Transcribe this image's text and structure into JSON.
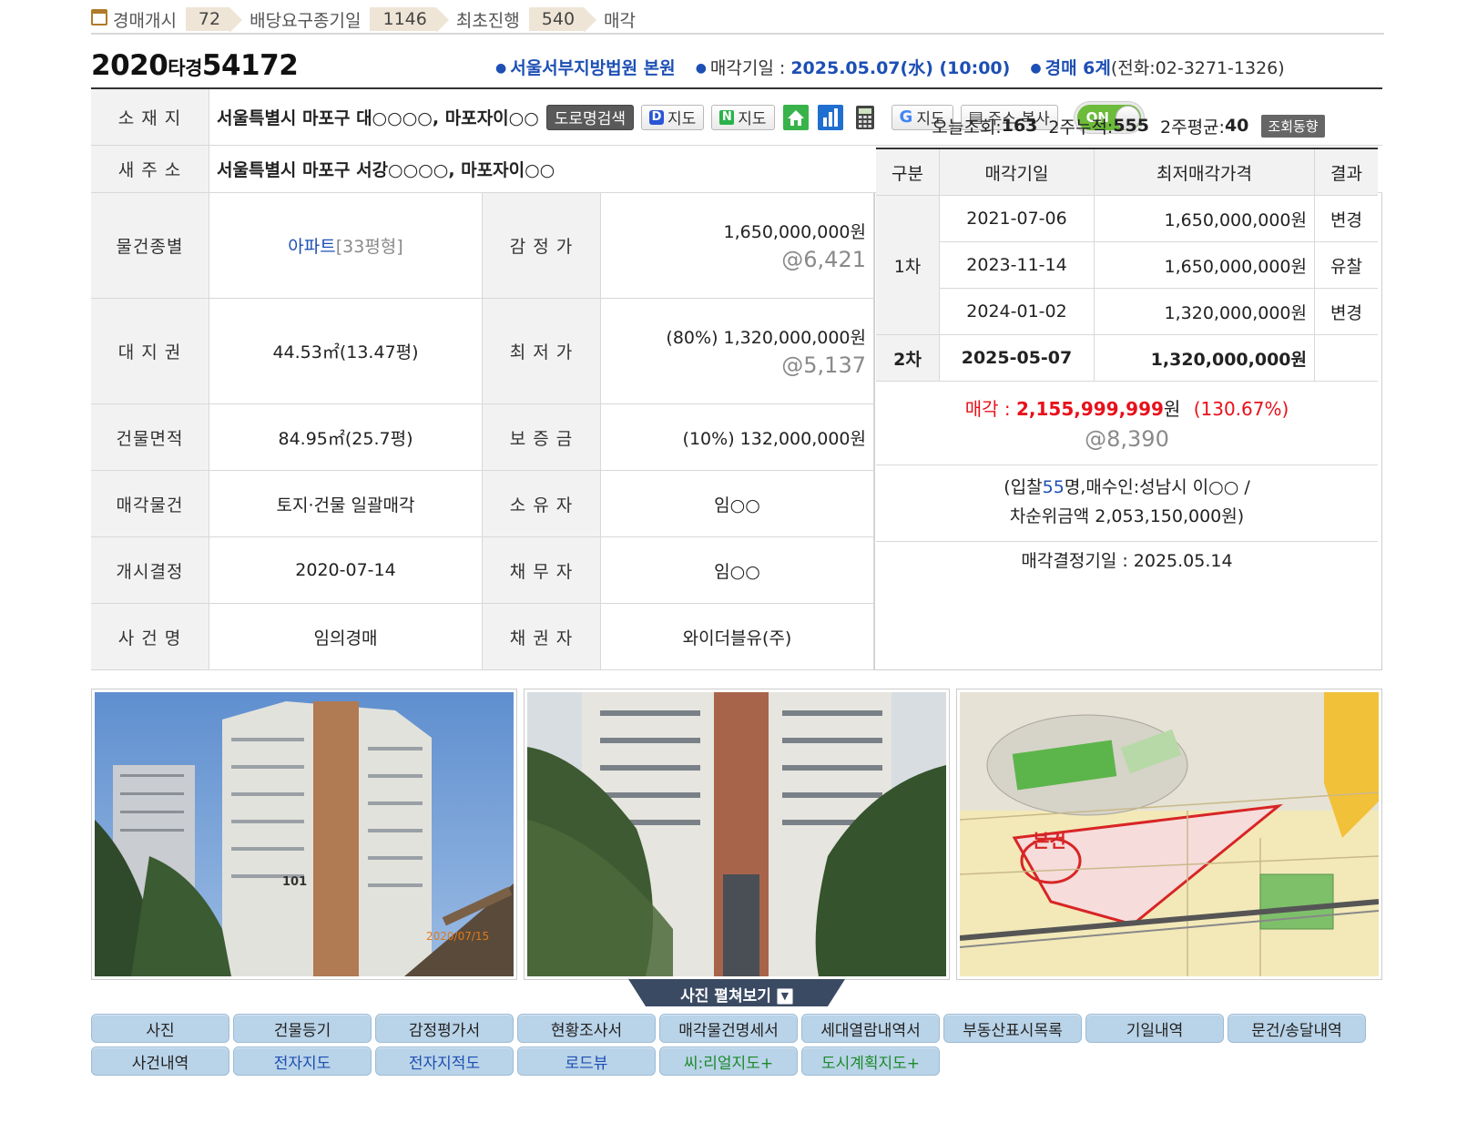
{
  "progress": [
    {
      "label": "경매개시",
      "count": "72"
    },
    {
      "label": "배당요구종기일",
      "count": "1146"
    },
    {
      "label": "최초진행",
      "count": "540"
    },
    {
      "label": "매각",
      "count": ""
    }
  ],
  "case": {
    "year": "2020",
    "type": "타경",
    "number": "54172",
    "court": "서울서부지방법원 본원",
    "sale_date_label": "매각기일 : ",
    "sale_date": "2025.05.07(水) (10:00)",
    "dept": "경매 6계",
    "phone": "(전화:02-3271-1326)"
  },
  "address": {
    "label": "소 재 지",
    "value": "서울특별시 마포구 대○○○○, 마포자이○○",
    "road_search": "도로명검색",
    "daum_map": "지도",
    "naver_map": "지도",
    "google_map": "지도",
    "copy": "주소 복사",
    "toggle": "ON"
  },
  "new_address": {
    "label": "새 주 소",
    "value": "서울특별시 마포구 서강○○○○, 마포자이○○"
  },
  "rows": [
    {
      "l1": "물건종별",
      "v1": "아파트",
      "v1b": "[33평형]",
      "l2": "감 정 가",
      "v2": "1,650,000,000원",
      "v2b": "@6,421"
    },
    {
      "l1": "대 지 권",
      "v1": "44.53㎡(13.47평)",
      "l2": "최 저 가",
      "v2": "(80%) 1,320,000,000원",
      "v2b": "@5,137"
    },
    {
      "l1": "건물면적",
      "v1": "84.95㎡(25.7평)",
      "l2": "보 증 금",
      "v2": "(10%) 132,000,000원"
    },
    {
      "l1": "매각물건",
      "v1": "토지·건물 일괄매각",
      "l2": "소 유 자",
      "v2": "임○○"
    },
    {
      "l1": "개시결정",
      "v1": "2020-07-14",
      "l2": "채 무 자",
      "v2": "임○○"
    },
    {
      "l1": "사 건 명",
      "v1": "임의경매",
      "l2": "채 권 자",
      "v2": "와이더블유(주)"
    }
  ],
  "views": {
    "today_label": "오늘조회: ",
    "today": "163",
    "week2_label": "2주누적: ",
    "week2": "555",
    "avg_label": "2주평균: ",
    "avg": "40",
    "trend_button": "조회동향"
  },
  "history": {
    "headers": [
      "구분",
      "매각기일",
      "최저매각가격",
      "결과"
    ],
    "rows": [
      {
        "round": "",
        "date": "2021-07-06",
        "price": "1,650,000,000원",
        "result": "변경"
      },
      {
        "round": "1차",
        "date": "2023-11-14",
        "price": "1,650,000,000원",
        "result": "유찰"
      },
      {
        "round": "",
        "date": "2024-01-02",
        "price": "1,320,000,000원",
        "result": "변경"
      },
      {
        "round": "2차",
        "date": "2025-05-07",
        "price": "1,320,000,000원",
        "result": ""
      }
    ]
  },
  "sale": {
    "label": "매각 : ",
    "price": "2,155,999,999",
    "unit": "원",
    "ratio": "(130.67%)",
    "per_unit": "@8,390"
  },
  "bid": {
    "line1_a": "(입찰",
    "count": "55",
    "line1_b": "명,매수인:성남시 이○○ /",
    "line2": "차순위금액 2,053,150,000원)"
  },
  "decision": "매각결정기일 : 2025.05.14",
  "photo_label": "101",
  "photo_stamp": "2020/07/15",
  "map_label": "본건",
  "expand_label": "사진 펼쳐보기",
  "docs": [
    {
      "label": "사진",
      "color": "normal"
    },
    {
      "label": "건물등기",
      "color": "normal"
    },
    {
      "label": "감정평가서",
      "color": "normal"
    },
    {
      "label": "현황조사서",
      "color": "normal"
    },
    {
      "label": "매각물건명세서",
      "color": "normal"
    },
    {
      "label": "세대열람내역서",
      "color": "normal"
    },
    {
      "label": "부동산표시목록",
      "color": "normal"
    },
    {
      "label": "기일내역",
      "color": "normal"
    },
    {
      "label": "문건/송달내역",
      "color": "normal"
    },
    {
      "label": "사건내역",
      "color": "normal"
    },
    {
      "label": "전자지도",
      "color": "blue"
    },
    {
      "label": "전자지적도",
      "color": "blue"
    },
    {
      "label": "로드뷰",
      "color": "blue"
    },
    {
      "label": "씨:리얼지도+",
      "color": "green"
    },
    {
      "label": "도시계획지도+",
      "color": "green"
    }
  ],
  "colors": {
    "accent_blue": "#1d4fb4",
    "sale_red": "#e8101a",
    "doc_button": "#b9d3e8",
    "toggle_on": "#6cbb3a"
  }
}
